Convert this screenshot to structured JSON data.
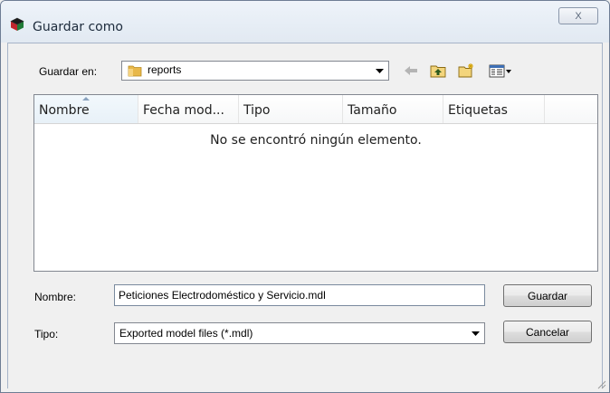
{
  "window": {
    "title": "Guardar como",
    "close_label": "X"
  },
  "location": {
    "label": "Guardar en:",
    "value": "reports"
  },
  "toolbar": {
    "icons": [
      "back-arrow-icon",
      "up-folder-icon",
      "new-folder-icon",
      "view-menu-icon"
    ]
  },
  "filelist": {
    "columns": [
      "Nombre",
      "Fecha mod...",
      "Tipo",
      "Tamaño",
      "Etiquetas"
    ],
    "sorted_column": "Nombre",
    "empty_message": "No se encontró ningún elemento."
  },
  "filename": {
    "label": "Nombre:",
    "value": "Peticiones Electrodoméstico y Servicio.mdl"
  },
  "filetype": {
    "label": "Tipo:",
    "value": "Exported model files (*.mdl)"
  },
  "buttons": {
    "save": "Guardar",
    "cancel": "Cancelar"
  },
  "colors": {
    "titlebar": "#e6edf5",
    "window_bg": "#f0f0f0",
    "folder": "#e8b84a"
  }
}
